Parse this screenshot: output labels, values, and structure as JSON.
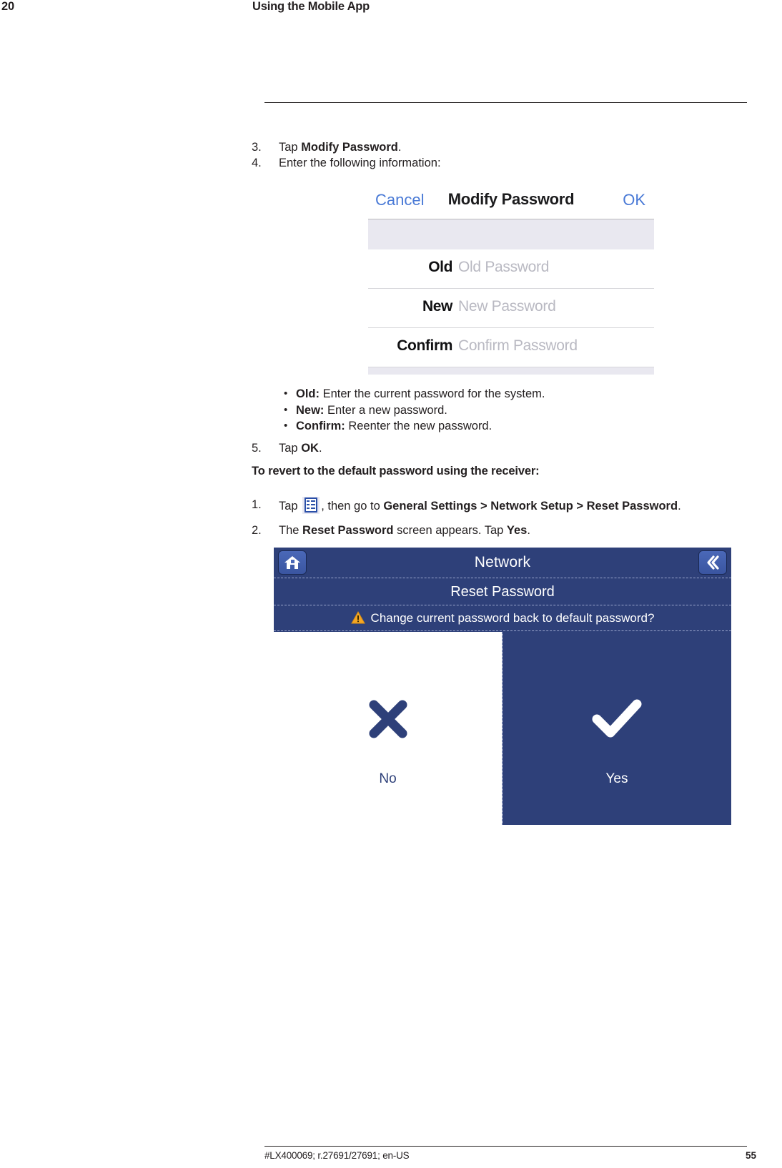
{
  "header": {
    "page_number": "20",
    "chapter_title": "Using the Mobile App"
  },
  "steps": {
    "step3": {
      "number": "3.",
      "text_before": "Tap ",
      "bold": "Modify Password",
      "text_after": "."
    },
    "step4": {
      "number": "4.",
      "text": "Enter the following information:"
    },
    "step5": {
      "number": "5.",
      "text_before": "Tap ",
      "bold": "OK",
      "text_after": "."
    }
  },
  "mobile_dialog": {
    "cancel_label": "Cancel",
    "title": "Modify Password",
    "ok_label": "OK",
    "fields": [
      {
        "label": "Old",
        "placeholder": "Old Password"
      },
      {
        "label": "New",
        "placeholder": "New Password"
      },
      {
        "label": "Confirm",
        "placeholder": "Confirm Password"
      }
    ]
  },
  "bullets": [
    {
      "marker": "•",
      "term": "Old:",
      "description": " Enter the current password for the system."
    },
    {
      "marker": "•",
      "term": "New:",
      "description": " Enter a new password."
    },
    {
      "marker": "•",
      "term": "Confirm:",
      "description": " Reenter the new password."
    }
  ],
  "revert_section": {
    "heading": "To revert to the default password using the receiver:",
    "step1": {
      "number": "1.",
      "text_before": "Tap ",
      "icon_name": "menu-icon",
      "text_middle": ", then go to ",
      "bold": "General Settings > Network Setup > Reset Password",
      "text_after": "."
    },
    "step2": {
      "number": "2.",
      "text_before": "The ",
      "bold1": "Reset Password",
      "text_middle": " screen appears. Tap ",
      "bold2": "Yes",
      "text_after": "."
    }
  },
  "receiver_screen": {
    "title": "Network",
    "home_icon": "home-icon",
    "back_icon": "back-chevron-icon",
    "subtitle": "Reset Password",
    "warning_icon": "warning-triangle-icon",
    "question": "Change current password back to default password?",
    "choices": [
      {
        "label": "No",
        "icon": "cross-icon"
      },
      {
        "label": "Yes",
        "icon": "check-icon"
      }
    ],
    "colors": {
      "background": "#2e4079",
      "button": "#4a68b8",
      "warning": "#f5a623",
      "text": "#ffffff"
    }
  },
  "footer": {
    "document_id": "#LX400069; r.27691/27691; en-US",
    "page_number": "55"
  }
}
